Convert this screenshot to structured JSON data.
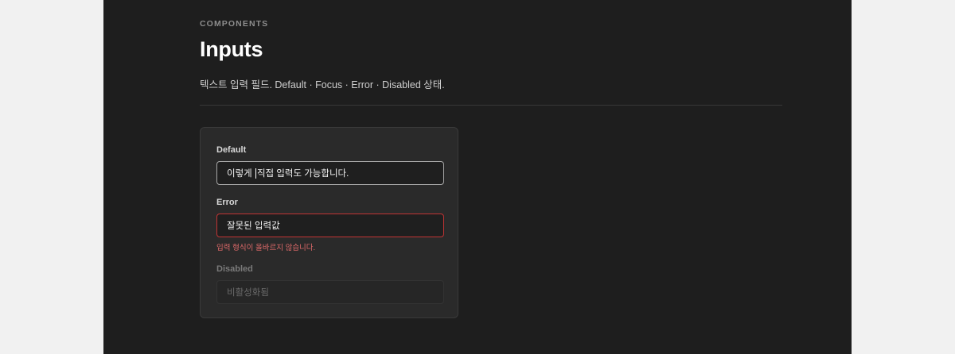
{
  "header": {
    "eyebrow": "COMPONENTS",
    "title": "Inputs",
    "description": "텍스트 입력 필드. Default · Focus · Error · Disabled 상태."
  },
  "inputs": {
    "default": {
      "label": "Default",
      "value_before_caret": "이렇게 ",
      "value_after_caret": "직접 입력도 가능합니다."
    },
    "error": {
      "label": "Error",
      "value": "잘못된 입력값",
      "message": "입력 형식이 올바르지 않습니다."
    },
    "disabled": {
      "label": "Disabled",
      "placeholder": "비활성화됨"
    }
  },
  "colors": {
    "stage_bg": "#1e1e1e",
    "card_bg": "#2a2a2a",
    "error": "#c23434",
    "error_text": "#e06a6a",
    "focus_border": "#a8a8a8"
  }
}
